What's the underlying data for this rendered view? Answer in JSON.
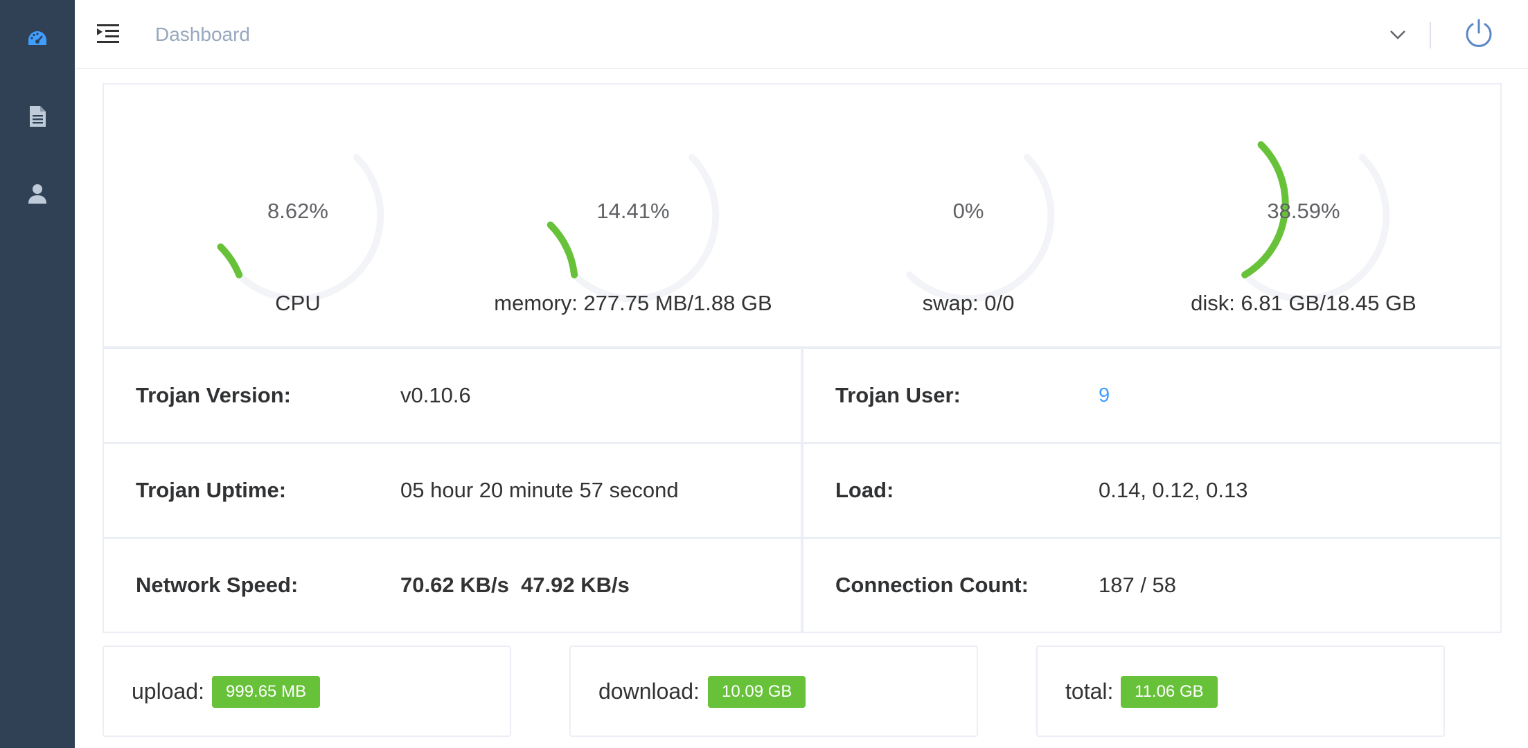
{
  "sidebar": {
    "items": [
      {
        "icon": "dashboard-icon",
        "active": true
      },
      {
        "icon": "document-icon",
        "active": false
      },
      {
        "icon": "user-icon",
        "active": false
      }
    ],
    "bg_color": "#304156",
    "active_color": "#409eff",
    "inactive_color": "#bfcbd9"
  },
  "header": {
    "title": "Dashboard",
    "menu_icon": "menu-fold-icon",
    "dropdown_icon": "chevron-down-icon",
    "power_icon": "power-icon"
  },
  "gauges": [
    {
      "value_text": "8.62%",
      "percent": 8.62,
      "label": "CPU"
    },
    {
      "value_text": "14.41%",
      "percent": 14.41,
      "label": "memory: 277.75 MB/1.88 GB"
    },
    {
      "value_text": "0%",
      "percent": 0,
      "label": "swap: 0/0"
    },
    {
      "value_text": "38.59%",
      "percent": 38.59,
      "label": "disk: 6.81 GB/18.45 GB"
    }
  ],
  "gauge_colors": {
    "track": "#f3f4f7",
    "fill": "#67c23a"
  },
  "info": {
    "version_label": "Trojan Version:",
    "version_value": "v0.10.6",
    "user_label": "Trojan User:",
    "user_value": "9",
    "uptime_label": "Trojan Uptime:",
    "uptime_value": "05 hour 20 minute 57 second",
    "load_label": "Load:",
    "load_value": "0.14, 0.12, 0.13",
    "speed_label": "Network Speed:",
    "speed_up": "70.62 KB/s",
    "speed_down": "47.92 KB/s",
    "conn_label": "Connection Count:",
    "conn_value": "187 / 58"
  },
  "traffic": {
    "upload_label": "upload:",
    "upload_value": "999.65 MB",
    "download_label": "download:",
    "download_value": "10.09 GB",
    "total_label": "total:",
    "total_value": "11.06 GB"
  }
}
